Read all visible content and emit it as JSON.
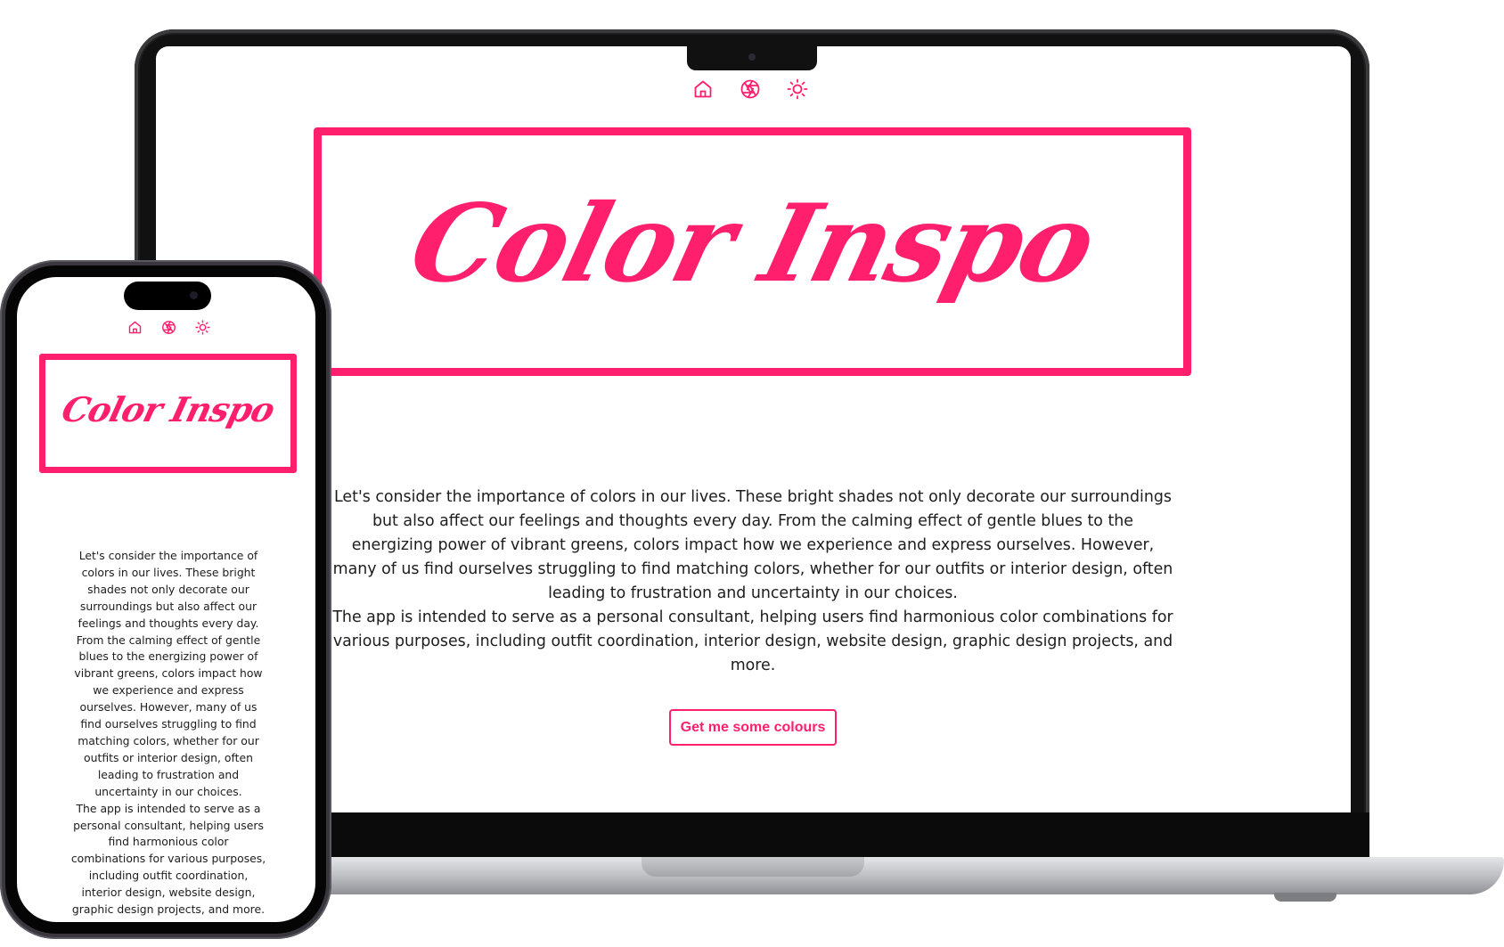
{
  "colors": {
    "accent": "#ff1f6d",
    "text": "#1d1d1f",
    "background": "#ffffff"
  },
  "nav": {
    "icons": [
      "home-icon",
      "aperture-icon",
      "sun-icon"
    ]
  },
  "hero": {
    "title": "Color Inspo"
  },
  "intro": {
    "paragraph_1": "Let's consider the importance of colors in our lives. These bright shades not only decorate our surroundings but also affect our feelings and thoughts every day. From the calming effect of gentle blues to the energizing power of vibrant greens, colors impact how we experience and express ourselves. However, many of us find ourselves struggling to find matching colors, whether for our outfits or interior design, often leading to frustration and uncertainty in our choices.",
    "paragraph_2": "The app is intended to serve as a personal consultant, helping users find harmonious color combinations for various purposes, including outfit coordination, interior design, website design, graphic design projects, and more."
  },
  "cta": {
    "label": "Get me some colours"
  }
}
